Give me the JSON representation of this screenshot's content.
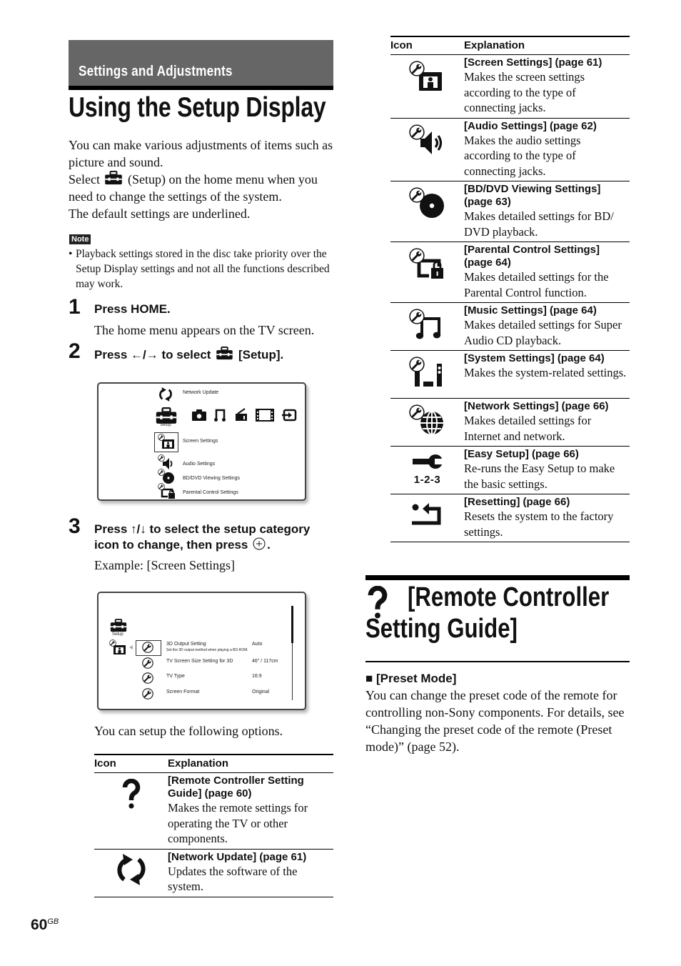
{
  "header": {
    "section": "Settings and Adjustments",
    "title": "Using the Setup Display"
  },
  "intro": {
    "line1": "You can make various adjustments of items such as picture and sound.",
    "line2_before": "Select",
    "line2_after": "(Setup) on the home menu when you need to change the settings of the system.",
    "line3": "The default settings are underlined."
  },
  "note": {
    "label": "Note",
    "bullet": "•",
    "text": "Playback settings stored in the disc take priority over the Setup Display settings and not all the functions described may work."
  },
  "steps": [
    {
      "num": "1",
      "head": "Press HOME.",
      "body": "The home menu appears on the TV screen."
    },
    {
      "num": "2",
      "head_before": "Press ←/→ to select",
      "head_after": "[Setup]."
    },
    {
      "num": "3",
      "head_before": "Press ↑/↓ to select the setup category icon to change, then press",
      "head_after": ".",
      "body": "Example: [Screen Settings]"
    }
  ],
  "screen1": {
    "network_update": "Network Update",
    "setup_label": "Setup",
    "items": [
      "Screen Settings",
      "Audio Settings",
      "BD/DVD Viewing Settings",
      "Parental Control Settings"
    ]
  },
  "screen2": {
    "setup_label": "Setup",
    "rows": [
      {
        "name": "3D Output Setting",
        "value": "Auto",
        "desc": "Set the 3D output method when playing a BD-ROM."
      },
      {
        "name": "TV Screen Size Setting for 3D",
        "value": "46\" / 117cm"
      },
      {
        "name": "TV Type",
        "value": "16:9"
      },
      {
        "name": "Screen Format",
        "value": "Original"
      }
    ]
  },
  "after_screen": "You can setup the following options.",
  "table_left": {
    "headers": [
      "Icon",
      "Explanation"
    ],
    "rows": [
      {
        "icon": "question-icon",
        "head": "[Remote Controller Setting Guide] (page 60)",
        "desc": "Makes the remote settings for operating the TV or other components."
      },
      {
        "icon": "network-update-icon",
        "head": "[Network Update] (page 61)",
        "desc": "Updates the software of the system."
      }
    ]
  },
  "table_right": {
    "headers": [
      "Icon",
      "Explanation"
    ],
    "rows": [
      {
        "icon": "screen-settings-icon",
        "head": "[Screen Settings] (page 61)",
        "desc": "Makes the screen settings according to the type of connecting jacks."
      },
      {
        "icon": "audio-settings-icon",
        "head": "[Audio Settings] (page 62)",
        "desc": "Makes the audio settings according to the type of connecting jacks."
      },
      {
        "icon": "disc-settings-icon",
        "head": "[BD/DVD Viewing Settings] (page 63)",
        "desc": "Makes detailed settings for BD/ DVD playback."
      },
      {
        "icon": "parental-control-icon",
        "head": "[Parental Control Settings] (page 64)",
        "desc": "Makes detailed settings for the Parental Control function."
      },
      {
        "icon": "music-settings-icon",
        "head": "[Music Settings] (page 64)",
        "desc": "Makes detailed settings for Super Audio CD playback."
      },
      {
        "icon": "system-settings-icon",
        "head": "[System Settings] (page 64)",
        "desc": "Makes the system-related settings."
      },
      {
        "icon": "network-settings-icon",
        "head": "[Network Settings] (page 66)",
        "desc": "Makes detailed settings for Internet and network."
      },
      {
        "icon": "easy-setup-icon",
        "head": "[Easy Setup] (page 66)",
        "desc": "Re-runs the Easy Setup to make the basic settings.",
        "icon_text": "1-2-3"
      },
      {
        "icon": "resetting-icon",
        "head": "[Resetting] (page 66)",
        "desc": "Resets the system to the factory settings."
      }
    ]
  },
  "remote_section": {
    "title": "[Remote Controller Setting Guide]",
    "sub_marker": "■",
    "sub_head": "[Preset Mode]",
    "body": "You can change the preset code of the remote for controlling non-Sony components. For details, see “Changing the preset code of the remote (Preset mode)” (page 52)."
  },
  "footer": {
    "page": "60",
    "suffix": "GB"
  }
}
